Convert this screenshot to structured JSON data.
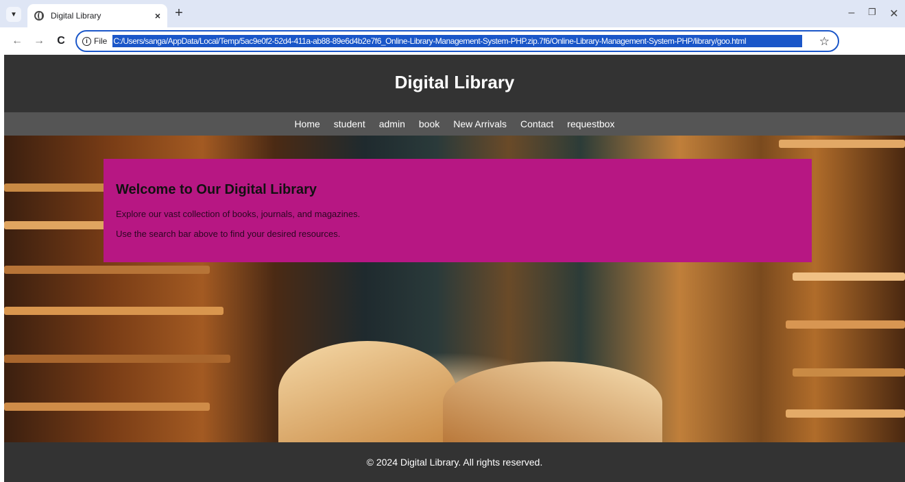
{
  "browser": {
    "tab_title": "Digital Library",
    "close_glyph": "×",
    "new_tab_glyph": "+",
    "site_info_label": "File",
    "url": "C:/Users/sanga/AppData/Local/Temp/5ac9e0f2-52d4-411a-ab88-89e6d4b2e7f6_Online-Library-Management-System-PHP.zip.7f6/Online-Library-Management-System-PHP/library/goo.html",
    "icons": [
      "tab-search-icon",
      "globe-icon",
      "close-icon",
      "new-tab-icon",
      "minimize-icon",
      "restore-icon",
      "window-close-icon",
      "back-icon",
      "forward-icon",
      "reload-icon",
      "info-icon",
      "star-icon",
      "side-panel-icon",
      "profile-icon",
      "menu-icon"
    ]
  },
  "header": {
    "title": "Digital Library"
  },
  "nav": {
    "items": [
      "Home",
      "student",
      "admin",
      "book",
      "New Arrivals",
      "Contact",
      "requestbox"
    ]
  },
  "welcome": {
    "title": "Welcome to Our Digital Library",
    "line1": "Explore our vast collection of books, journals, and magazines.",
    "line2": "Use the search bar above to find your desired resources."
  },
  "footer": {
    "text": "© 2024 Digital Library. All rights reserved."
  },
  "colors": {
    "header_bg": "#333333",
    "nav_bg": "#555555",
    "welcome_bg": "#b71783",
    "footer_bg": "#333333",
    "url_highlight": "#1a56c8"
  }
}
